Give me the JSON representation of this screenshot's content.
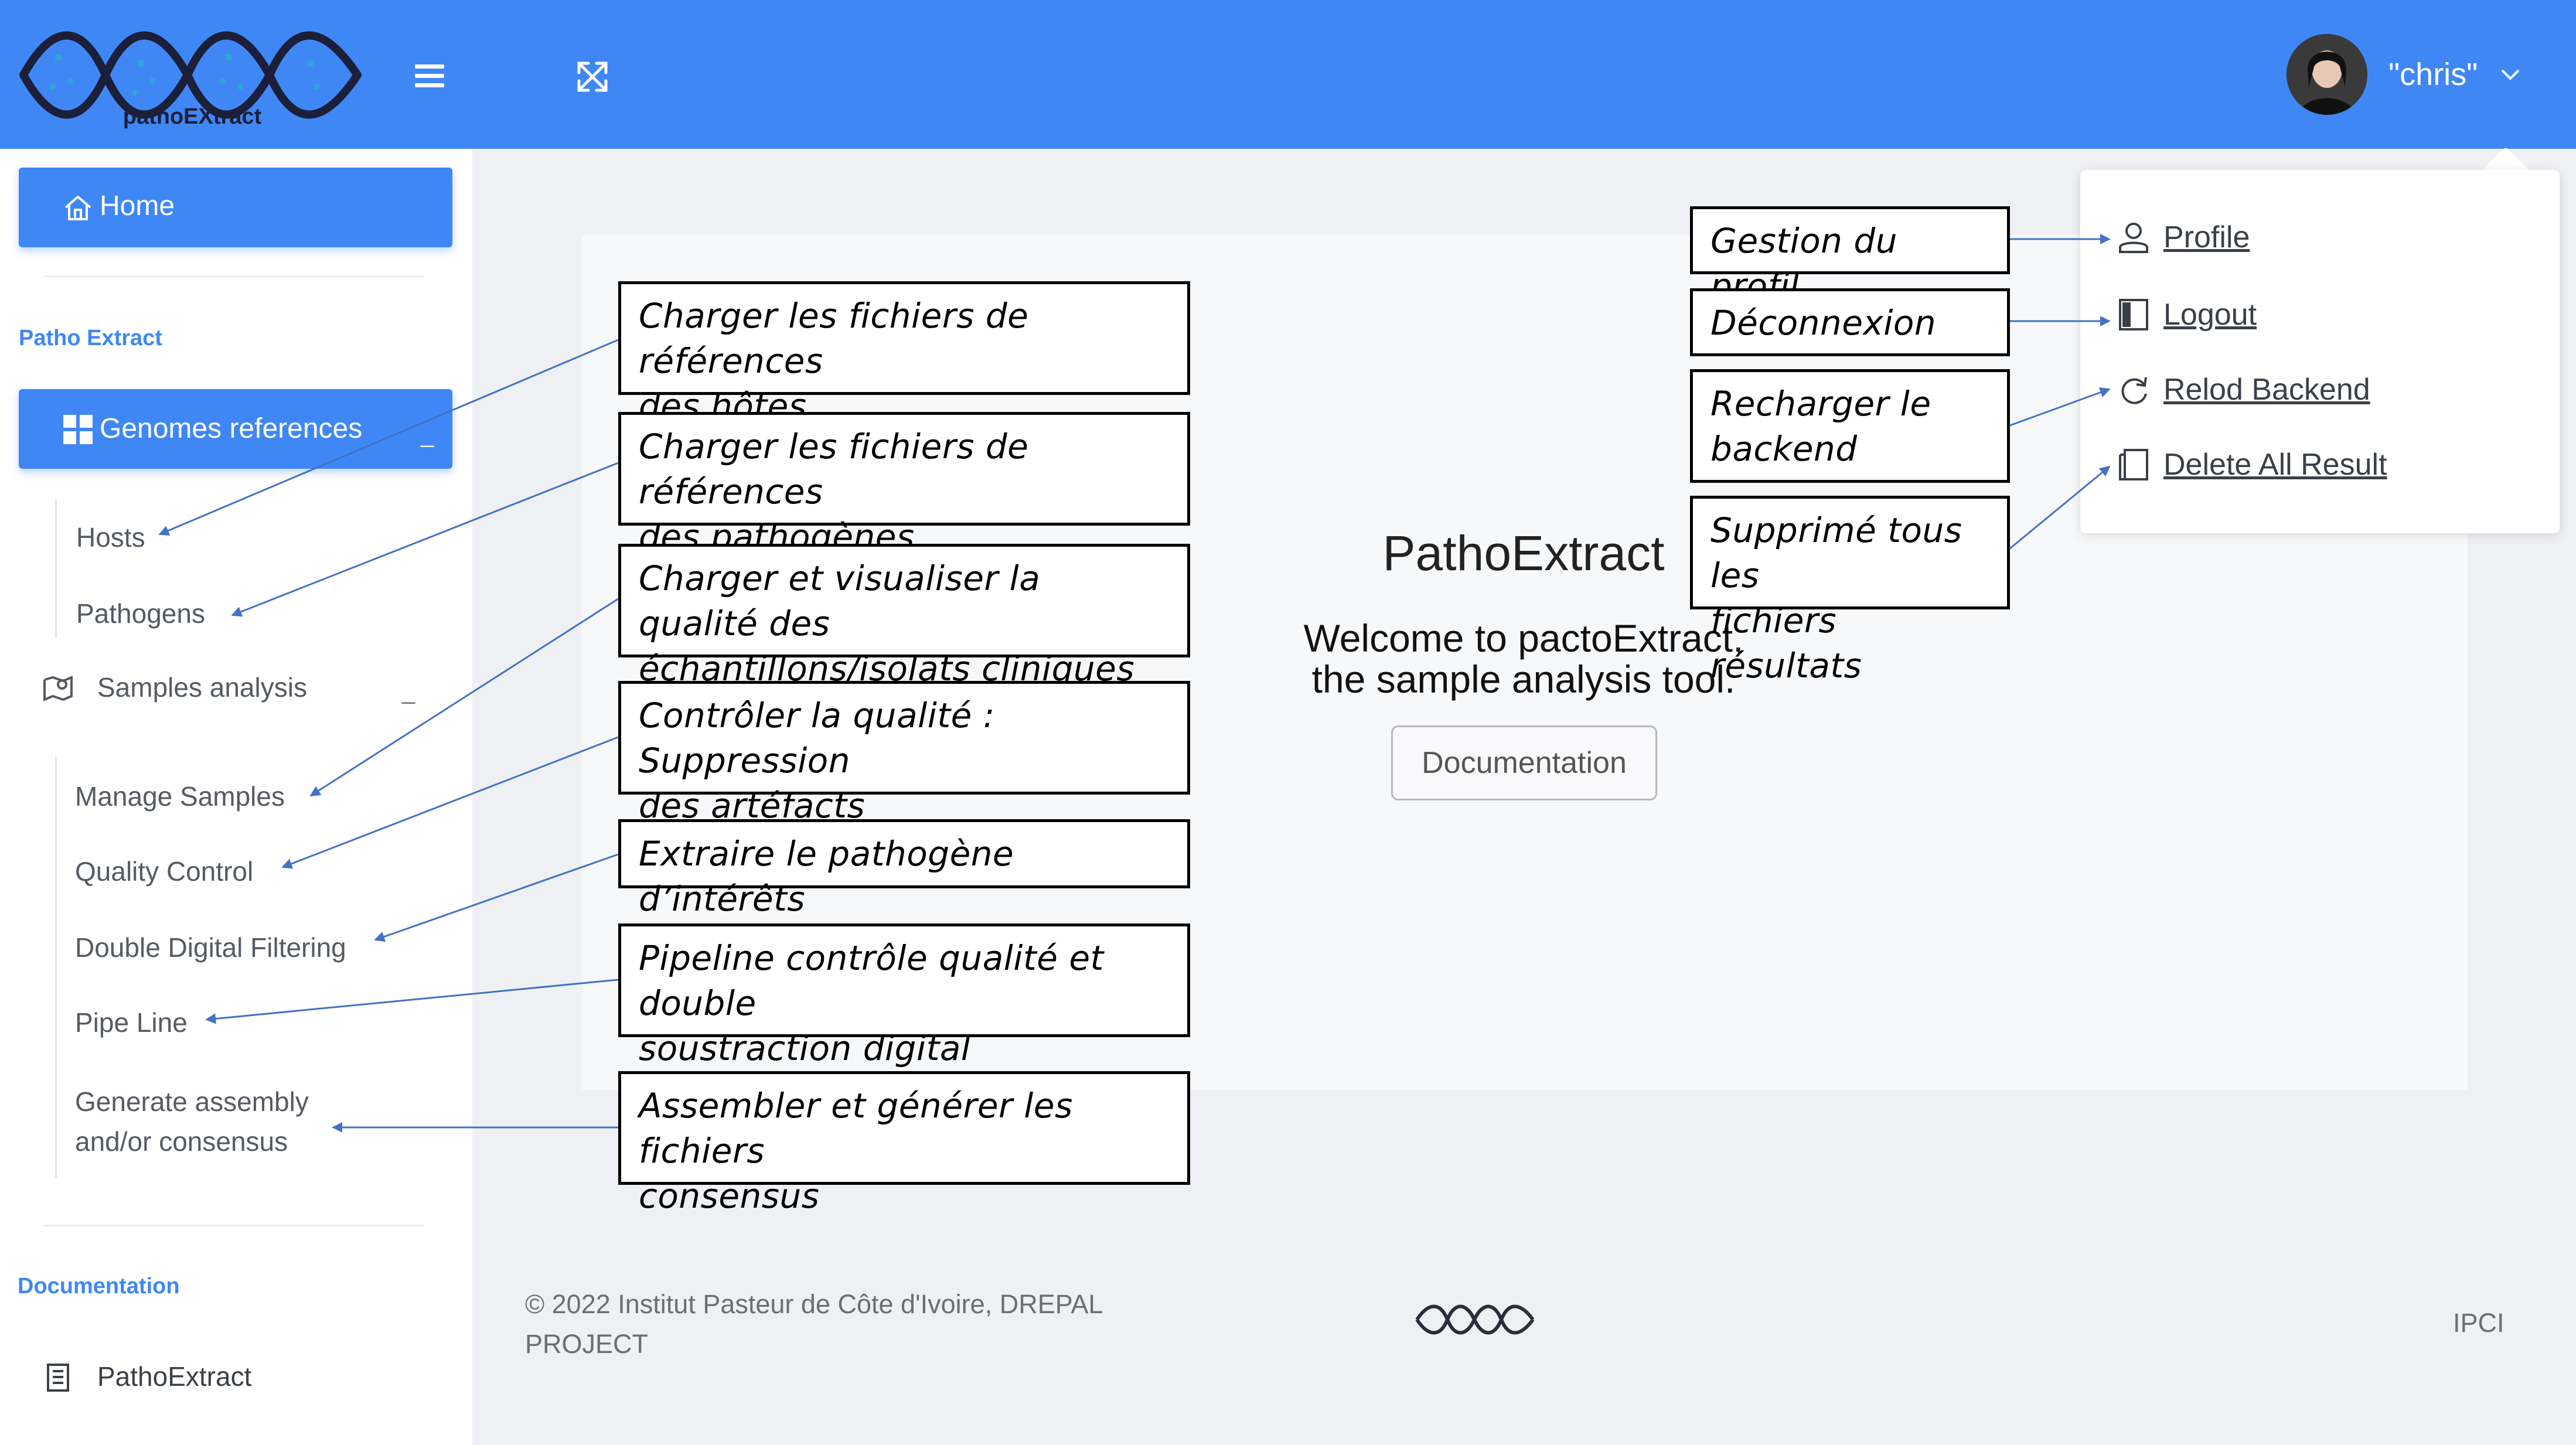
{
  "header": {
    "logo_text": "pathoEXtract",
    "user_name": "\"chris\""
  },
  "sidebar": {
    "home_label": "Home",
    "section_patho": "Patho Extract",
    "genomes_label": "Genomes references",
    "genomes_toggle": "_",
    "hosts_label": "Hosts",
    "pathogens_label": "Pathogens",
    "samples_label": "Samples analysis",
    "samples_toggle": "_",
    "manage_samples": "Manage Samples",
    "quality_control": "Quality Control",
    "double_digital": "Double Digital Filtering",
    "pipe_line": "Pipe Line",
    "generate_assembly_1": "Generate assembly",
    "generate_assembly_2": "and/or consensus",
    "section_docs": "Documentation",
    "docs_item": "PathoExtract"
  },
  "main": {
    "title": "PathoExtract",
    "welcome_line1": "Welcome to pactoExtract,",
    "welcome_line2": "the sample analysis tool.",
    "doc_button": "Documentation"
  },
  "dropdown": {
    "profile": "Profile",
    "logout": "Logout",
    "reload_backend": "Relod Backend",
    "delete_all": "Delete All Result"
  },
  "footer": {
    "copyright_line1": "© 2022 Institut Pasteur de Côte d'Ivoire, DREPAL",
    "copyright_line2": "PROJECT",
    "right_text": "IPCI"
  },
  "annotations": {
    "hosts": [
      "Charger les fichiers de références",
      "des hôtes"
    ],
    "pathogens": [
      "Charger les fichiers de références",
      "des pathogènes"
    ],
    "manage_samples": [
      "Charger et visualiser la qualité des",
      "échantillons/isolats cliniques"
    ],
    "quality_control": [
      "Contrôler la qualité : Suppression",
      "des artéfacts"
    ],
    "double_digital": [
      "Extraire le pathogène d’intérêts"
    ],
    "pipeline": [
      "Pipeline contrôle qualité et double",
      "soustraction digital"
    ],
    "assembly": [
      "Assembler et générer les fichiers",
      "consensus"
    ],
    "profile": [
      "Gestion du profil"
    ],
    "logout": [
      "Déconnexion"
    ],
    "reload": [
      "Recharger le",
      "backend"
    ],
    "delete": [
      "Supprimé tous les",
      "fichiers résultats"
    ]
  },
  "colors": {
    "primary": "#3f87f5",
    "arrow": "#4472c4",
    "main_bg": "#eef0f3"
  }
}
